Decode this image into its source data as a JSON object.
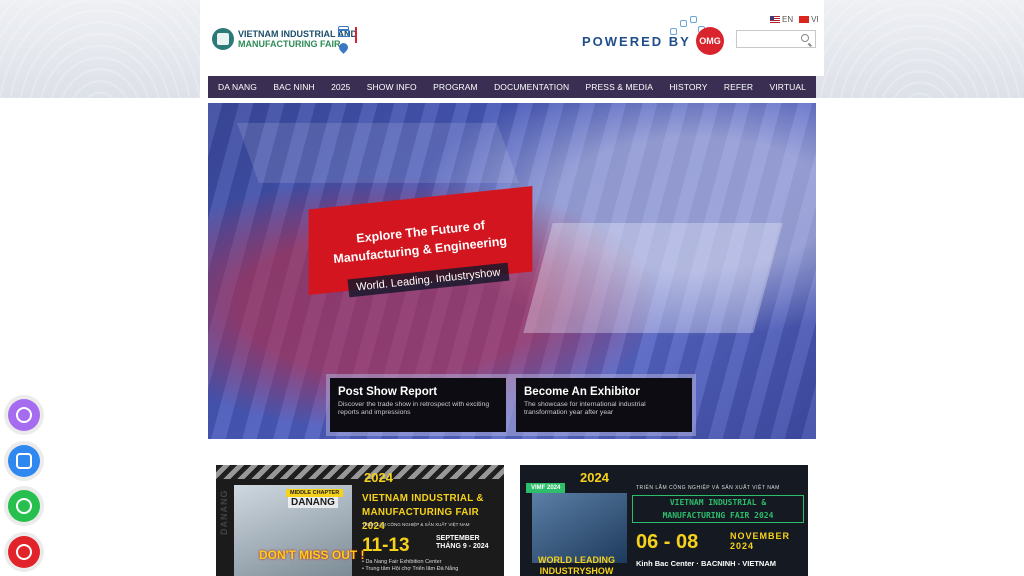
{
  "header": {
    "logo_line1": "VIETNAM INDUSTRIAL AND",
    "logo_line2": "MANUFACTURING FAIR",
    "powered_by": "POWERED BY",
    "powered_brand": "OMG",
    "lang_en": "EN",
    "lang_vi": "VI",
    "search_placeholder": ""
  },
  "nav": {
    "items": [
      "DA NANG",
      "BAC NINH",
      "2025",
      "SHOW INFO",
      "PROGRAM",
      "DOCUMENTATION",
      "PRESS & MEDIA",
      "HISTORY",
      "REFER",
      "VIRTUAL"
    ]
  },
  "hero": {
    "headline_1": "Explore The Future of",
    "headline_2": "Manufacturing & Engineering",
    "tagline": "World. Leading. Industryshow",
    "cards": [
      {
        "title": "Post Show Report",
        "desc": "Discover the trade show in retrospect with exciting reports and impressions"
      },
      {
        "title": "Become An Exhibitor",
        "desc": "The showcase for international industrial transformation year after year"
      }
    ]
  },
  "promo1": {
    "year": "2024",
    "chapter": "MIDDLE CHAPTER",
    "city": "DANANG",
    "miss": "DON'T MISS OUT !",
    "side": "DANANG",
    "title_1": "VIETNAM INDUSTRIAL &",
    "title_2": "MANUFACTURING FAIR 2024",
    "sub": "TRIỂN LÃM CÔNG NGHIỆP & SẢN XUẤT VIỆT NAM",
    "dates": "11-13",
    "month_1": "SEPTEMBER",
    "month_2": "THÁNG 9 - 2024",
    "venue_1": "• Da Nang Fair Exhibition Center",
    "venue_2": "• Trung tâm Hội chợ Triển lãm Đà Nẵng"
  },
  "promo2": {
    "year": "2024",
    "badge": "VIMF 2024",
    "vn": "TRIỂN LÃM CÔNG NGHIỆP VÀ SẢN XUẤT VIỆT NAM",
    "title_1": "VIETNAM INDUSTRIAL &",
    "title_2": "MANUFACTURING FAIR 2024",
    "dates": "06 - 08",
    "month_1": "NOVEMBER",
    "month_2": "2024",
    "venue": "Kinh Bac Center · BACNINH - VIETNAM",
    "wl_1": "WORLD LEADING",
    "wl_2": "INDUSTRYSHOW"
  }
}
